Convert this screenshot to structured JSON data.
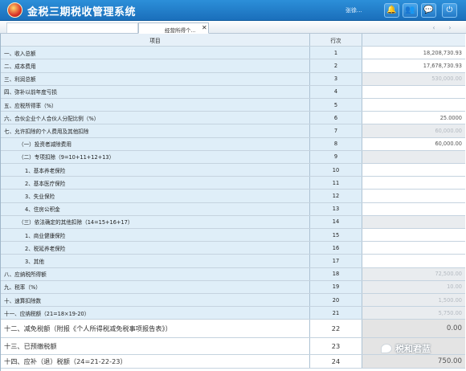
{
  "window": {
    "title": "金税三期税收管理系统",
    "user_text": "张徐..."
  },
  "toolbar": {
    "buttons": [
      {
        "name": "bell-icon",
        "glyph": "🔔"
      },
      {
        "name": "users-icon",
        "glyph": "👥"
      },
      {
        "name": "chat-icon",
        "glyph": "💬"
      },
      {
        "name": "power-icon",
        "glyph": "⏻"
      }
    ]
  },
  "tabs": {
    "active_label": "经营所得个...",
    "close_glyph": "✕",
    "prev_glyph": "‹",
    "next_glyph": "›"
  },
  "table": {
    "headers": {
      "item": "项目",
      "line_no": "行次",
      "amount": ""
    },
    "rows": [
      {
        "item": "一、收入总额",
        "no": "1",
        "amount": "18,208,730.93",
        "editable": true
      },
      {
        "item": "二、成本费用",
        "no": "2",
        "amount": "17,678,730.93",
        "editable": true
      },
      {
        "item": "三、利润总额",
        "no": "3",
        "amount": "530,000.00",
        "editable": false
      },
      {
        "item": "四、弥补以前年度亏损",
        "no": "4",
        "amount": "",
        "editable": true
      },
      {
        "item": "五、应税所得率（%）",
        "no": "5",
        "amount": "",
        "editable": true
      },
      {
        "item": "六、合伙企业个人合伙人分配比例（%）",
        "no": "6",
        "amount": "25.0000",
        "editable": true
      },
      {
        "item": "七、允许扣除的个人费用及其他扣除",
        "no": "7",
        "amount": "60,000.00",
        "editable": false
      },
      {
        "item": "（一）投资者减除费用",
        "no": "8",
        "amount": "60,000.00",
        "editable": true
      },
      {
        "item": "（二）专项扣除（9=10+11+12+13）",
        "no": "9",
        "amount": "",
        "editable": false
      },
      {
        "item": "1、基本养老保险",
        "no": "10",
        "amount": "",
        "editable": true
      },
      {
        "item": "2、基本医疗保险",
        "no": "11",
        "amount": "",
        "editable": true
      },
      {
        "item": "3、失业保险",
        "no": "12",
        "amount": "",
        "editable": true
      },
      {
        "item": "4、住房公积金",
        "no": "13",
        "amount": "",
        "editable": true
      },
      {
        "item": "（三）依法确定的其他扣除（14=15+16+17）",
        "no": "14",
        "amount": "",
        "editable": false
      },
      {
        "item": "1、商业健康保险",
        "no": "15",
        "amount": "",
        "editable": true
      },
      {
        "item": "2、税延养老保险",
        "no": "16",
        "amount": "",
        "editable": true
      },
      {
        "item": "3、其他",
        "no": "17",
        "amount": "",
        "editable": true
      },
      {
        "item": "八、应纳税所得额",
        "no": "18",
        "amount": "72,500.00",
        "editable": false
      },
      {
        "item": "九、税率（%）",
        "no": "19",
        "amount": "10.00",
        "editable": false
      },
      {
        "item": "十、速算扣除数",
        "no": "20",
        "amount": "1,500.00",
        "editable": false
      },
      {
        "item": "十一、应纳税额（21=18×19-20）",
        "no": "21",
        "amount": "5,750.00",
        "editable": false
      }
    ],
    "big_rows": [
      {
        "item": "十二、减免税额（附报《个人所得税减免税事项报告表》）",
        "no": "22",
        "amount": "0.00"
      },
      {
        "item": "十三、已预缴税额",
        "no": "23",
        "amount": ""
      },
      {
        "item": "十四、应补（退）税额（24=21-22-23）",
        "no": "24",
        "amount": "750.00"
      }
    ]
  },
  "watermark": {
    "text": "税和君蓝"
  }
}
